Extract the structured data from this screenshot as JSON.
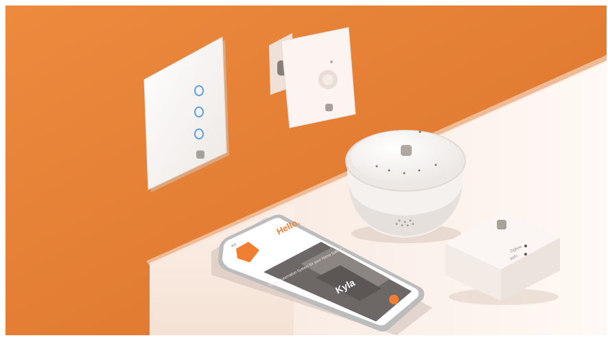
{
  "scene": {
    "colors": {
      "wall": "#ec8338",
      "wall_dark": "#d96e26",
      "shelf_top": "#fbeee6",
      "shelf_front": "#fff6f1",
      "device_white": "#f7f3f0",
      "button_ring": "#6aa7e8",
      "accent_orange": "#f07f32"
    },
    "phone": {
      "greeting": "Hello.",
      "headline": "\"Smart Automation System for your Home Safety\"",
      "brand": "Kyla",
      "status_time": "4:0"
    },
    "bridge": {
      "label_1": "Zigbee",
      "label_2": "WiFi"
    }
  }
}
